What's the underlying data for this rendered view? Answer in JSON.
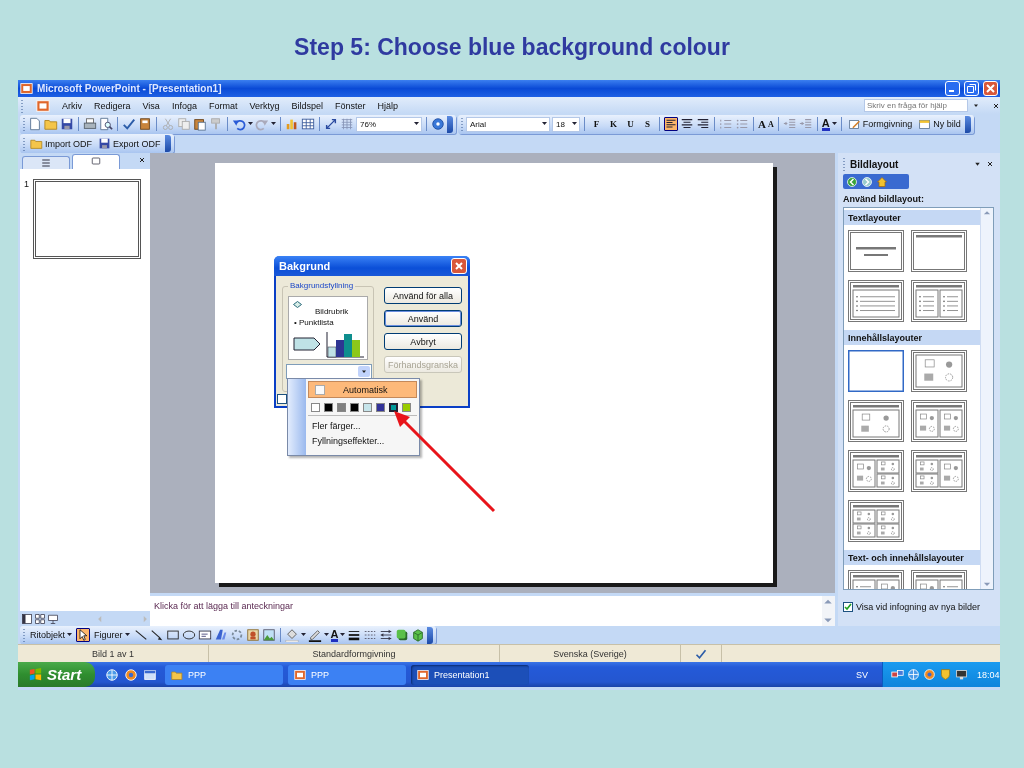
{
  "heading": "Step 5: Choose blue background colour",
  "window": {
    "title": "Microsoft PowerPoint - [Presentation1]"
  },
  "menu": [
    "Arkiv",
    "Redigera",
    "Visa",
    "Infoga",
    "Format",
    "Verktyg",
    "Bildspel",
    "Fönster",
    "Hjälp"
  ],
  "help_field": {
    "placeholder": "Skriv en fråga för hjälp"
  },
  "standard_toolbar": {
    "zoom": "76%"
  },
  "formatting_toolbar": {
    "font": "Arial",
    "font_size": "18",
    "style_buttons": [
      "F",
      "K",
      "U",
      "S"
    ],
    "align": [
      {
        "selected": true
      },
      {
        "selected": false
      },
      {
        "selected": false
      }
    ],
    "size_buttons": [
      "A",
      "A"
    ],
    "font_color": "A",
    "buttons": [
      "Formgivning",
      "Ny bild"
    ]
  },
  "odf_toolbar": [
    "Import ODF",
    "Export ODF"
  ],
  "slide_pane": {
    "tabs": [
      {
        "selected": false
      },
      {
        "selected": true
      }
    ],
    "slides": [
      "1"
    ]
  },
  "notes": {
    "prompt": "Klicka för att lägga till anteckningar"
  },
  "dialog": {
    "title": "Bakgrund",
    "group": "Bakgrundsfyllning",
    "preview": {
      "title": "Bildrubrik",
      "bullet": "• Punktlista"
    },
    "checkbox": {
      "checked": false
    },
    "buttons": [
      {
        "label": "Använd för alla",
        "default": false,
        "disabled": false
      },
      {
        "label": "Använd",
        "default": true,
        "disabled": false
      },
      {
        "label": "Avbryt",
        "default": false,
        "disabled": false
      },
      {
        "label": "Förhandsgranska",
        "default": false,
        "disabled": true
      }
    ]
  },
  "color_menu": {
    "automatic": {
      "label": "Automatisk",
      "selected": true
    },
    "swatches": [
      {
        "color": "#ffffff",
        "selected": false
      },
      {
        "color": "#000000",
        "selected": false
      },
      {
        "color": "#808080",
        "selected": false
      },
      {
        "color": "#000000",
        "selected": false
      },
      {
        "color": "#c6e4ea",
        "selected": false
      },
      {
        "color": "#333399",
        "selected": false
      },
      {
        "color": "#009999",
        "selected": true
      },
      {
        "color": "#99cc00",
        "selected": false
      }
    ],
    "items": [
      {
        "label": "Fler färger...",
        "selected": false
      },
      {
        "label": "Fyllningseffekter...",
        "selected": false
      }
    ]
  },
  "task_pane": {
    "title": "Bildlayout",
    "heading": "Använd bildlayout:",
    "sections": [
      {
        "title": "Textlayouter",
        "layouts": [
          {
            "kind": "title",
            "selected": false
          },
          {
            "kind": "title-only",
            "selected": false
          },
          {
            "kind": "title-bullets",
            "selected": false
          },
          {
            "kind": "title-two-bullets",
            "selected": false
          }
        ]
      },
      {
        "title": "Innehållslayouter",
        "layouts": [
          {
            "kind": "blank",
            "selected": true
          },
          {
            "kind": "content",
            "selected": false
          },
          {
            "kind": "title-content",
            "selected": false
          },
          {
            "kind": "title-two-content",
            "selected": false
          },
          {
            "kind": "title-content-two-small",
            "selected": false
          },
          {
            "kind": "title-two-small-content",
            "selected": false
          },
          {
            "kind": "title-four-content",
            "selected": false
          }
        ]
      },
      {
        "title": "Text- och innehållslayouter",
        "layouts": [
          {
            "kind": "title-bullets-content",
            "selected": false
          },
          {
            "kind": "title-content-bullets",
            "selected": false
          }
        ]
      }
    ],
    "show_on_insert": {
      "label": "Visa vid infogning av nya bilder",
      "checked": true
    }
  },
  "drawing_toolbar": {
    "menus": [
      "Ritobjekt",
      "Figurer"
    ],
    "pointer": {
      "selected": true
    },
    "font_color": "A"
  },
  "status_bar": [
    "Bild 1 av 1",
    "Standardformgivning",
    "Svenska (Sverige)"
  ],
  "taskbar": {
    "start": "Start",
    "tasks": [
      {
        "label": "PPP",
        "kind": "folder",
        "selected": false
      },
      {
        "label": "PPP",
        "kind": "presentation",
        "selected": false
      },
      {
        "label": "Presentation1",
        "kind": "presentation",
        "selected": true
      }
    ],
    "language": "SV",
    "clock": "18:04"
  }
}
